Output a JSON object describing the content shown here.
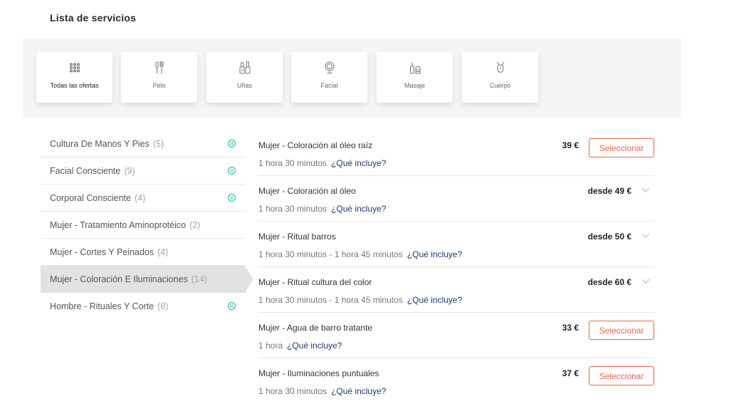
{
  "page": {
    "title": "Lista de servicios"
  },
  "categories": [
    {
      "label": "Todas las ofertas",
      "icon": "grid-dots-icon",
      "active": true
    },
    {
      "label": "Pelo",
      "icon": "hair-tools-icon",
      "active": false
    },
    {
      "label": "Uñas",
      "icon": "nail-polish-icon",
      "active": false
    },
    {
      "label": "Facial",
      "icon": "mirror-icon",
      "active": false
    },
    {
      "label": "Masaje",
      "icon": "massage-oil-icon",
      "active": false
    },
    {
      "label": "Cuerpo",
      "icon": "body-icon",
      "active": false
    }
  ],
  "sidebar": {
    "items": [
      {
        "label": "Cultura De Manos Y Pies",
        "count": "(5)",
        "promo": true
      },
      {
        "label": "Facial Consciente",
        "count": "(9)",
        "promo": true
      },
      {
        "label": "Corporal Consciente",
        "count": "(4)",
        "promo": true
      },
      {
        "label": "Mujer - Tratamiento Aminoprotéico",
        "count": "(2)",
        "promo": false
      },
      {
        "label": "Mujer - Cortes Y Peinados",
        "count": "(4)",
        "promo": false
      },
      {
        "label": "Mujer - Coloración E Iluminaciones",
        "count": "(14)",
        "promo": false,
        "active": true
      },
      {
        "label": "Hombre - Rituales Y Corte",
        "count": "(8)",
        "promo": true
      }
    ]
  },
  "services": {
    "select_label": "Seleccionar",
    "includes_label": "¿Qué incluye?",
    "items": [
      {
        "name": "Mujer - Coloración al óleo raíz",
        "duration": "1 hora 30 minutos",
        "price": "39 €",
        "action": "select"
      },
      {
        "name": "Mujer - Coloración al óleo",
        "duration": "1 hora 30 minutos",
        "price": "desde 49 €",
        "action": "expand"
      },
      {
        "name": "Mujer - Ritual barros",
        "duration": "1 hora 30 minutos - 1 hora 45 minutos",
        "price": "desde 50 €",
        "action": "expand"
      },
      {
        "name": "Mujer - Ritual cultura del color",
        "duration": "1 hora 30 minutos - 1 hora 45 minutos",
        "price": "desde 60 €",
        "action": "expand"
      },
      {
        "name": "Mujer - Agua de barro tratante",
        "duration": "1 hora",
        "price": "33 €",
        "action": "select"
      },
      {
        "name": "Mujer - Iluminaciones puntuales",
        "duration": "1 hora 30 minutos",
        "price": "37 €",
        "action": "select"
      }
    ]
  },
  "colors": {
    "accent": "#e8634f",
    "link": "#1f3a6e",
    "promo": "#1ab0a8",
    "active_bg": "#e2e2e2"
  }
}
